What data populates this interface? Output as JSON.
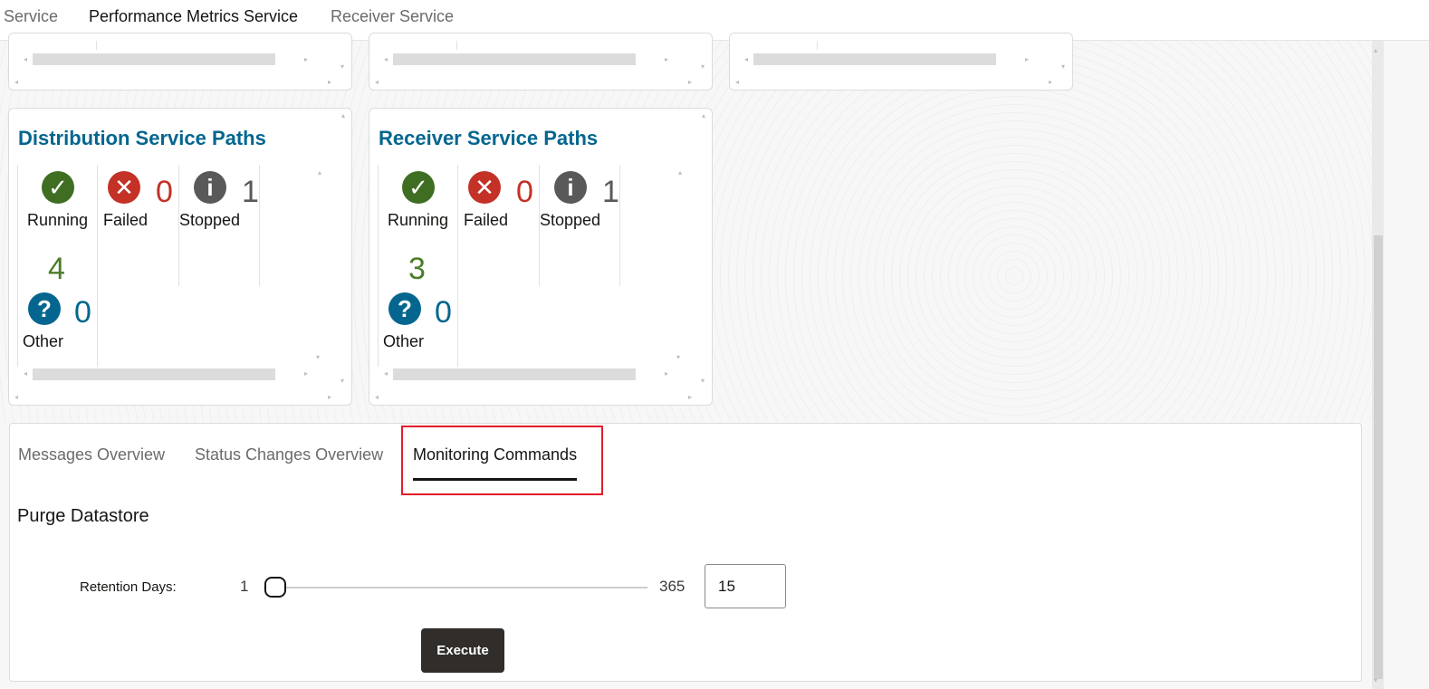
{
  "service_tabs": [
    {
      "label": "Service",
      "active": false
    },
    {
      "label": "Performance Metrics Service",
      "active": true
    },
    {
      "label": "Receiver Service",
      "active": false
    }
  ],
  "cards": {
    "distribution": {
      "title": "Distribution Service Paths",
      "running": {
        "label": "Running",
        "count": "4"
      },
      "failed": {
        "label": "Failed",
        "count": "0"
      },
      "stopped": {
        "label": "Stopped",
        "count": "1"
      },
      "other": {
        "label": "Other",
        "count": "0"
      }
    },
    "receiver": {
      "title": "Receiver Service Paths",
      "running": {
        "label": "Running",
        "count": "3"
      },
      "failed": {
        "label": "Failed",
        "count": "0"
      },
      "stopped": {
        "label": "Stopped",
        "count": "1"
      },
      "other": {
        "label": "Other",
        "count": "0"
      }
    }
  },
  "sub_tabs": [
    {
      "label": "Messages Overview",
      "active": false
    },
    {
      "label": "Status Changes Overview",
      "active": false
    },
    {
      "label": "Monitoring Commands",
      "active": true
    }
  ],
  "purge": {
    "title": "Purge Datastore",
    "retention_label": "Retention Days:",
    "slider_min": "1",
    "slider_max": "365",
    "retention_value": "15",
    "execute_label": "Execute"
  },
  "colors": {
    "title_blue": "#04668f",
    "running_green": "#3f6e22",
    "failed_red": "#c33127",
    "stopped_gray": "#595959",
    "highlight_red": "#e11d2b",
    "button_dark": "#312d2a"
  }
}
